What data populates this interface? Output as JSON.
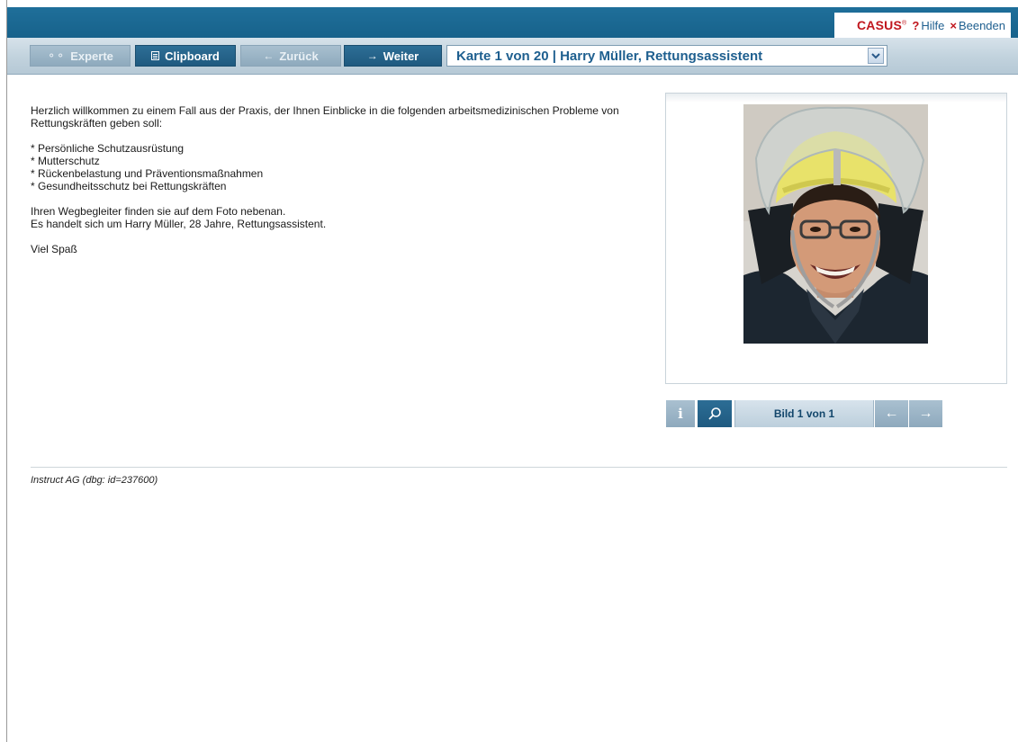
{
  "header": {
    "logo": "CASUS",
    "logo_mark": "®",
    "help_label": "Hilfe",
    "exit_label": "Beenden"
  },
  "toolbar": {
    "expert_label": "Experte",
    "clipboard_label": "Clipboard",
    "back_label": "Zurück",
    "next_label": "Weiter",
    "card_select": "Karte 1 von 20 | Harry Müller, Rettungsassistent"
  },
  "content": {
    "intro": "Herzlich willkommen zu einem Fall aus der Praxis, der Ihnen Einblicke in die folgenden arbeitsmedizinischen Probleme von Rettungskräften geben soll:",
    "topics": [
      "* Persönliche Schutzausrüstung",
      "* Mutterschutz",
      "* Rückenbelastung und Präventionsmaßnahmen",
      "* Gesundheitsschutz bei Rettungskräften"
    ],
    "guide_line1": "Ihren Wegbegleiter finden sie auf dem Foto nebenan.",
    "guide_line2": "Es handelt sich um Harry Müller, 28 Jahre, Rettungsassistent.",
    "closing": "Viel Spaß"
  },
  "image_panel": {
    "counter_label": "Bild 1 von 1",
    "info_icon": "info-icon",
    "zoom_icon": "magnifier-icon"
  },
  "footer": {
    "text": "Instruct AG (dbg: id=237600)"
  },
  "colors": {
    "brand_blue": "#17628b",
    "accent_red": "#c0161d",
    "link_blue": "#1e5f8f"
  }
}
